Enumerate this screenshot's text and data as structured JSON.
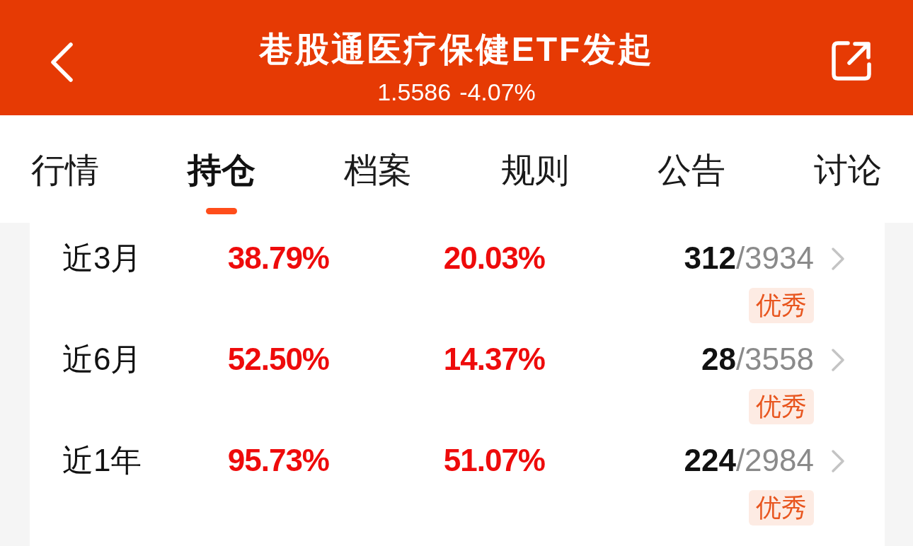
{
  "header": {
    "title": "巷股通医疗保健ETF发起",
    "price": "1.5586",
    "change": "-4.07%"
  },
  "tabs": [
    {
      "label": "行情",
      "selected": false
    },
    {
      "label": "持仓",
      "selected": true
    },
    {
      "label": "档案",
      "selected": false
    },
    {
      "label": "规则",
      "selected": false
    },
    {
      "label": "公告",
      "selected": false
    },
    {
      "label": "讨论",
      "selected": false
    }
  ],
  "rows": [
    {
      "label": "近3月",
      "column_2": "38.79%",
      "column_3": "20.03%",
      "rank": "312",
      "total": "/3934",
      "badge": "优秀"
    },
    {
      "label": "近6月",
      "column_2": "52.50%",
      "column_3": "14.37%",
      "rank": "28",
      "total": "/3558",
      "badge": "优秀"
    },
    {
      "label": "近1年",
      "column_2": "95.73%",
      "column_3": "51.07%",
      "rank": "224",
      "total": "/2984",
      "badge": "优秀"
    }
  ]
}
